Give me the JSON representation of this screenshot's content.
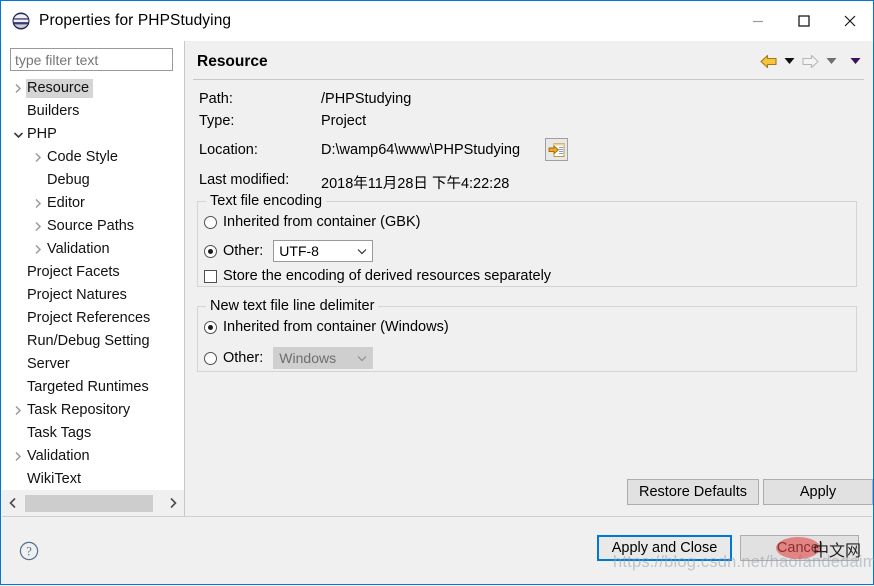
{
  "window": {
    "title": "Properties for PHPStudying",
    "icon": "eclipse-icon",
    "controls": {
      "minimize": "minimize-icon",
      "maximize": "maximize-icon",
      "close": "close-icon"
    }
  },
  "filter": {
    "placeholder": "type filter text",
    "value": ""
  },
  "tree": {
    "items": [
      {
        "label": "Resource",
        "indent": 0,
        "twisty": "chevron-right",
        "selected": true
      },
      {
        "label": "Builders",
        "indent": 0,
        "twisty": "none",
        "selected": false
      },
      {
        "label": "PHP",
        "indent": 0,
        "twisty": "chevron-down",
        "selected": false
      },
      {
        "label": "Code Style",
        "indent": 1,
        "twisty": "chevron-right",
        "selected": false
      },
      {
        "label": "Debug",
        "indent": 1,
        "twisty": "none",
        "selected": false
      },
      {
        "label": "Editor",
        "indent": 1,
        "twisty": "chevron-right",
        "selected": false
      },
      {
        "label": "Source Paths",
        "indent": 1,
        "twisty": "chevron-right",
        "selected": false
      },
      {
        "label": "Validation",
        "indent": 1,
        "twisty": "chevron-right",
        "selected": false
      },
      {
        "label": "Project Facets",
        "indent": 0,
        "twisty": "none",
        "selected": false
      },
      {
        "label": "Project Natures",
        "indent": 0,
        "twisty": "none",
        "selected": false
      },
      {
        "label": "Project References",
        "indent": 0,
        "twisty": "none",
        "selected": false
      },
      {
        "label": "Run/Debug Setting",
        "indent": 0,
        "twisty": "none",
        "selected": false
      },
      {
        "label": "Server",
        "indent": 0,
        "twisty": "none",
        "selected": false
      },
      {
        "label": "Targeted Runtimes",
        "indent": 0,
        "twisty": "none",
        "selected": false
      },
      {
        "label": "Task Repository",
        "indent": 0,
        "twisty": "chevron-right",
        "selected": false
      },
      {
        "label": "Task Tags",
        "indent": 0,
        "twisty": "none",
        "selected": false
      },
      {
        "label": "Validation",
        "indent": 0,
        "twisty": "chevron-right",
        "selected": false
      },
      {
        "label": "WikiText",
        "indent": 0,
        "twisty": "none",
        "selected": false
      }
    ],
    "scrollbar": {
      "left_arrow": "chevron-left-icon",
      "right_arrow": "chevron-right-icon"
    }
  },
  "page": {
    "title": "Resource",
    "nav": {
      "back": "back-arrow-icon",
      "back_menu": "dropdown-arrow-icon",
      "forward": "forward-arrow-icon",
      "forward_menu": "dropdown-arrow-icon",
      "view_menu": "dropdown-arrow-icon"
    },
    "properties": [
      {
        "label": "Path:",
        "value": "/PHPStudying"
      },
      {
        "label": "Type:",
        "value": "Project"
      },
      {
        "label": "Location:",
        "value": "D:\\wamp64\\www\\PHPStudying"
      },
      {
        "label": "Last modified:",
        "value": "2018年11月28日 下午4:22:28"
      }
    ],
    "location_button": "browse-location-icon",
    "encoding_group": {
      "legend": "Text file encoding",
      "inherited_label": "Inherited from container (GBK)",
      "inherited_selected": false,
      "other_label": "Other:",
      "other_selected": true,
      "other_value": "UTF-8",
      "store_derived_label": "Store the encoding of derived resources separately",
      "store_derived_checked": false
    },
    "delimiter_group": {
      "legend": "New text file line delimiter",
      "inherited_label": "Inherited from container (Windows)",
      "inherited_selected": true,
      "other_label": "Other:",
      "other_selected": false,
      "other_value": "Windows",
      "other_disabled": true
    },
    "restore_defaults_label": "Restore Defaults",
    "apply_label": "Apply"
  },
  "footer": {
    "help": "help-icon",
    "apply_and_close_label": "Apply and Close",
    "cancel_label": "Cancel"
  },
  "watermark": {
    "url": "https://blog.csdn.net/haofandedaima",
    "badge": "中文网"
  },
  "colors": {
    "accent": "#0078d7",
    "window_bg": "#f0f0f0",
    "panel_bg": "#ffffff",
    "selection": "#d5d5d5",
    "border": "#c8c8c8",
    "disabled_text": "#6d6d6d"
  }
}
